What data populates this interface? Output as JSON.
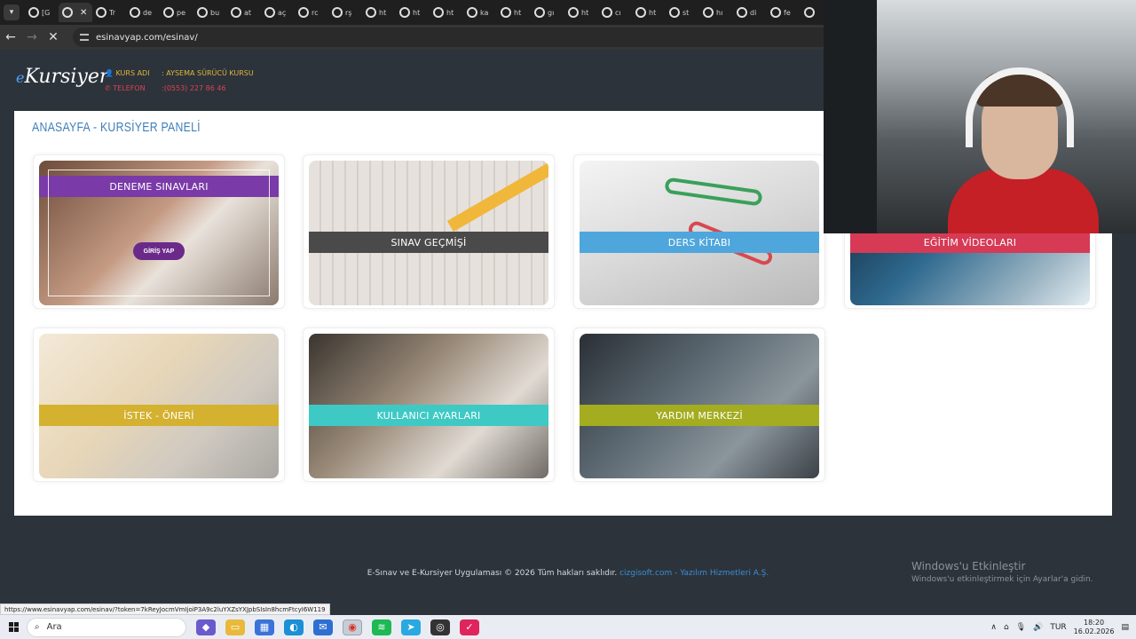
{
  "browser": {
    "tabs": [
      {
        "label": "[G",
        "active": false
      },
      {
        "label": "",
        "active": true
      },
      {
        "label": "Tr",
        "active": false
      },
      {
        "label": "de",
        "active": false
      },
      {
        "label": "pe",
        "active": false
      },
      {
        "label": "bu",
        "active": false
      },
      {
        "label": "at",
        "active": false
      },
      {
        "label": "aç",
        "active": false
      },
      {
        "label": "rc",
        "active": false
      },
      {
        "label": "rş",
        "active": false
      },
      {
        "label": "ht",
        "active": false
      },
      {
        "label": "ht",
        "active": false
      },
      {
        "label": "ht",
        "active": false
      },
      {
        "label": "ka",
        "active": false
      },
      {
        "label": "ht",
        "active": false
      },
      {
        "label": "gı",
        "active": false
      },
      {
        "label": "ht",
        "active": false
      },
      {
        "label": "cı",
        "active": false
      },
      {
        "label": "ht",
        "active": false
      },
      {
        "label": "st",
        "active": false
      },
      {
        "label": "hı",
        "active": false
      },
      {
        "label": "di",
        "active": false
      },
      {
        "label": "fe",
        "active": false
      },
      {
        "label": "",
        "active": false
      }
    ],
    "url": "esinavyap.com/esinav/",
    "status_url": "https://www.esinavyap.com/esinav/?token=7kReyJocmVmIjoiP3A9c2luYXZsYXJpbSIsIn8hcmFtcyI6W119"
  },
  "header": {
    "logo_e": "e",
    "logo_text": "Kursiyer",
    "course_label": "KURS ADI",
    "course_value": ": AYSEMA SÜRÜCÜ KURSU",
    "phone_label": "TELEFON",
    "phone_value": ":(0553) 227 86 46"
  },
  "page": {
    "title": "ANASAYFA - KURSİYER PANELİ",
    "cards": [
      {
        "label": "DENEME SINAVLARI",
        "band_color": "#7a3aa8",
        "button": "GİRİŞ YAP"
      },
      {
        "label": "SINAV GEÇMİŞİ",
        "band_color": "#4a4a4a"
      },
      {
        "label": "DERS KİTABI",
        "band_color": "#4ea6dc"
      },
      {
        "label": "EĞİTİM VİDEOLARI",
        "band_color": "#d63a55"
      },
      {
        "label": "İSTEK - ÖNERİ",
        "band_color": "#d4b12e"
      },
      {
        "label": "KULLANICI AYARLARI",
        "band_color": "#3ec9c5"
      },
      {
        "label": "YARDIM MERKEZİ",
        "band_color": "#a3ad1f"
      }
    ]
  },
  "footer": {
    "text": "E-Sınav ve E-Kursiyer Uygulaması © 2026 Tüm hakları saklıdır.",
    "link": "cizgisoft.com - Yazılım Hizmetleri A.Ş."
  },
  "watermark": {
    "line1": "Windows'u Etkinleştir",
    "line2": "Windows'u etkinleştirmek için Ayarlar'a gidin."
  },
  "taskbar": {
    "search_placeholder": "Ara",
    "lang": "TUR",
    "time": "18:20",
    "date": "16.02.2026",
    "app_icons": [
      "copilot-icon",
      "file-explorer-icon",
      "store-icon",
      "edge-icon",
      "mail-icon",
      "chrome-icon",
      "spotify-icon",
      "telegram-icon",
      "obs-icon",
      "app-icon"
    ]
  }
}
